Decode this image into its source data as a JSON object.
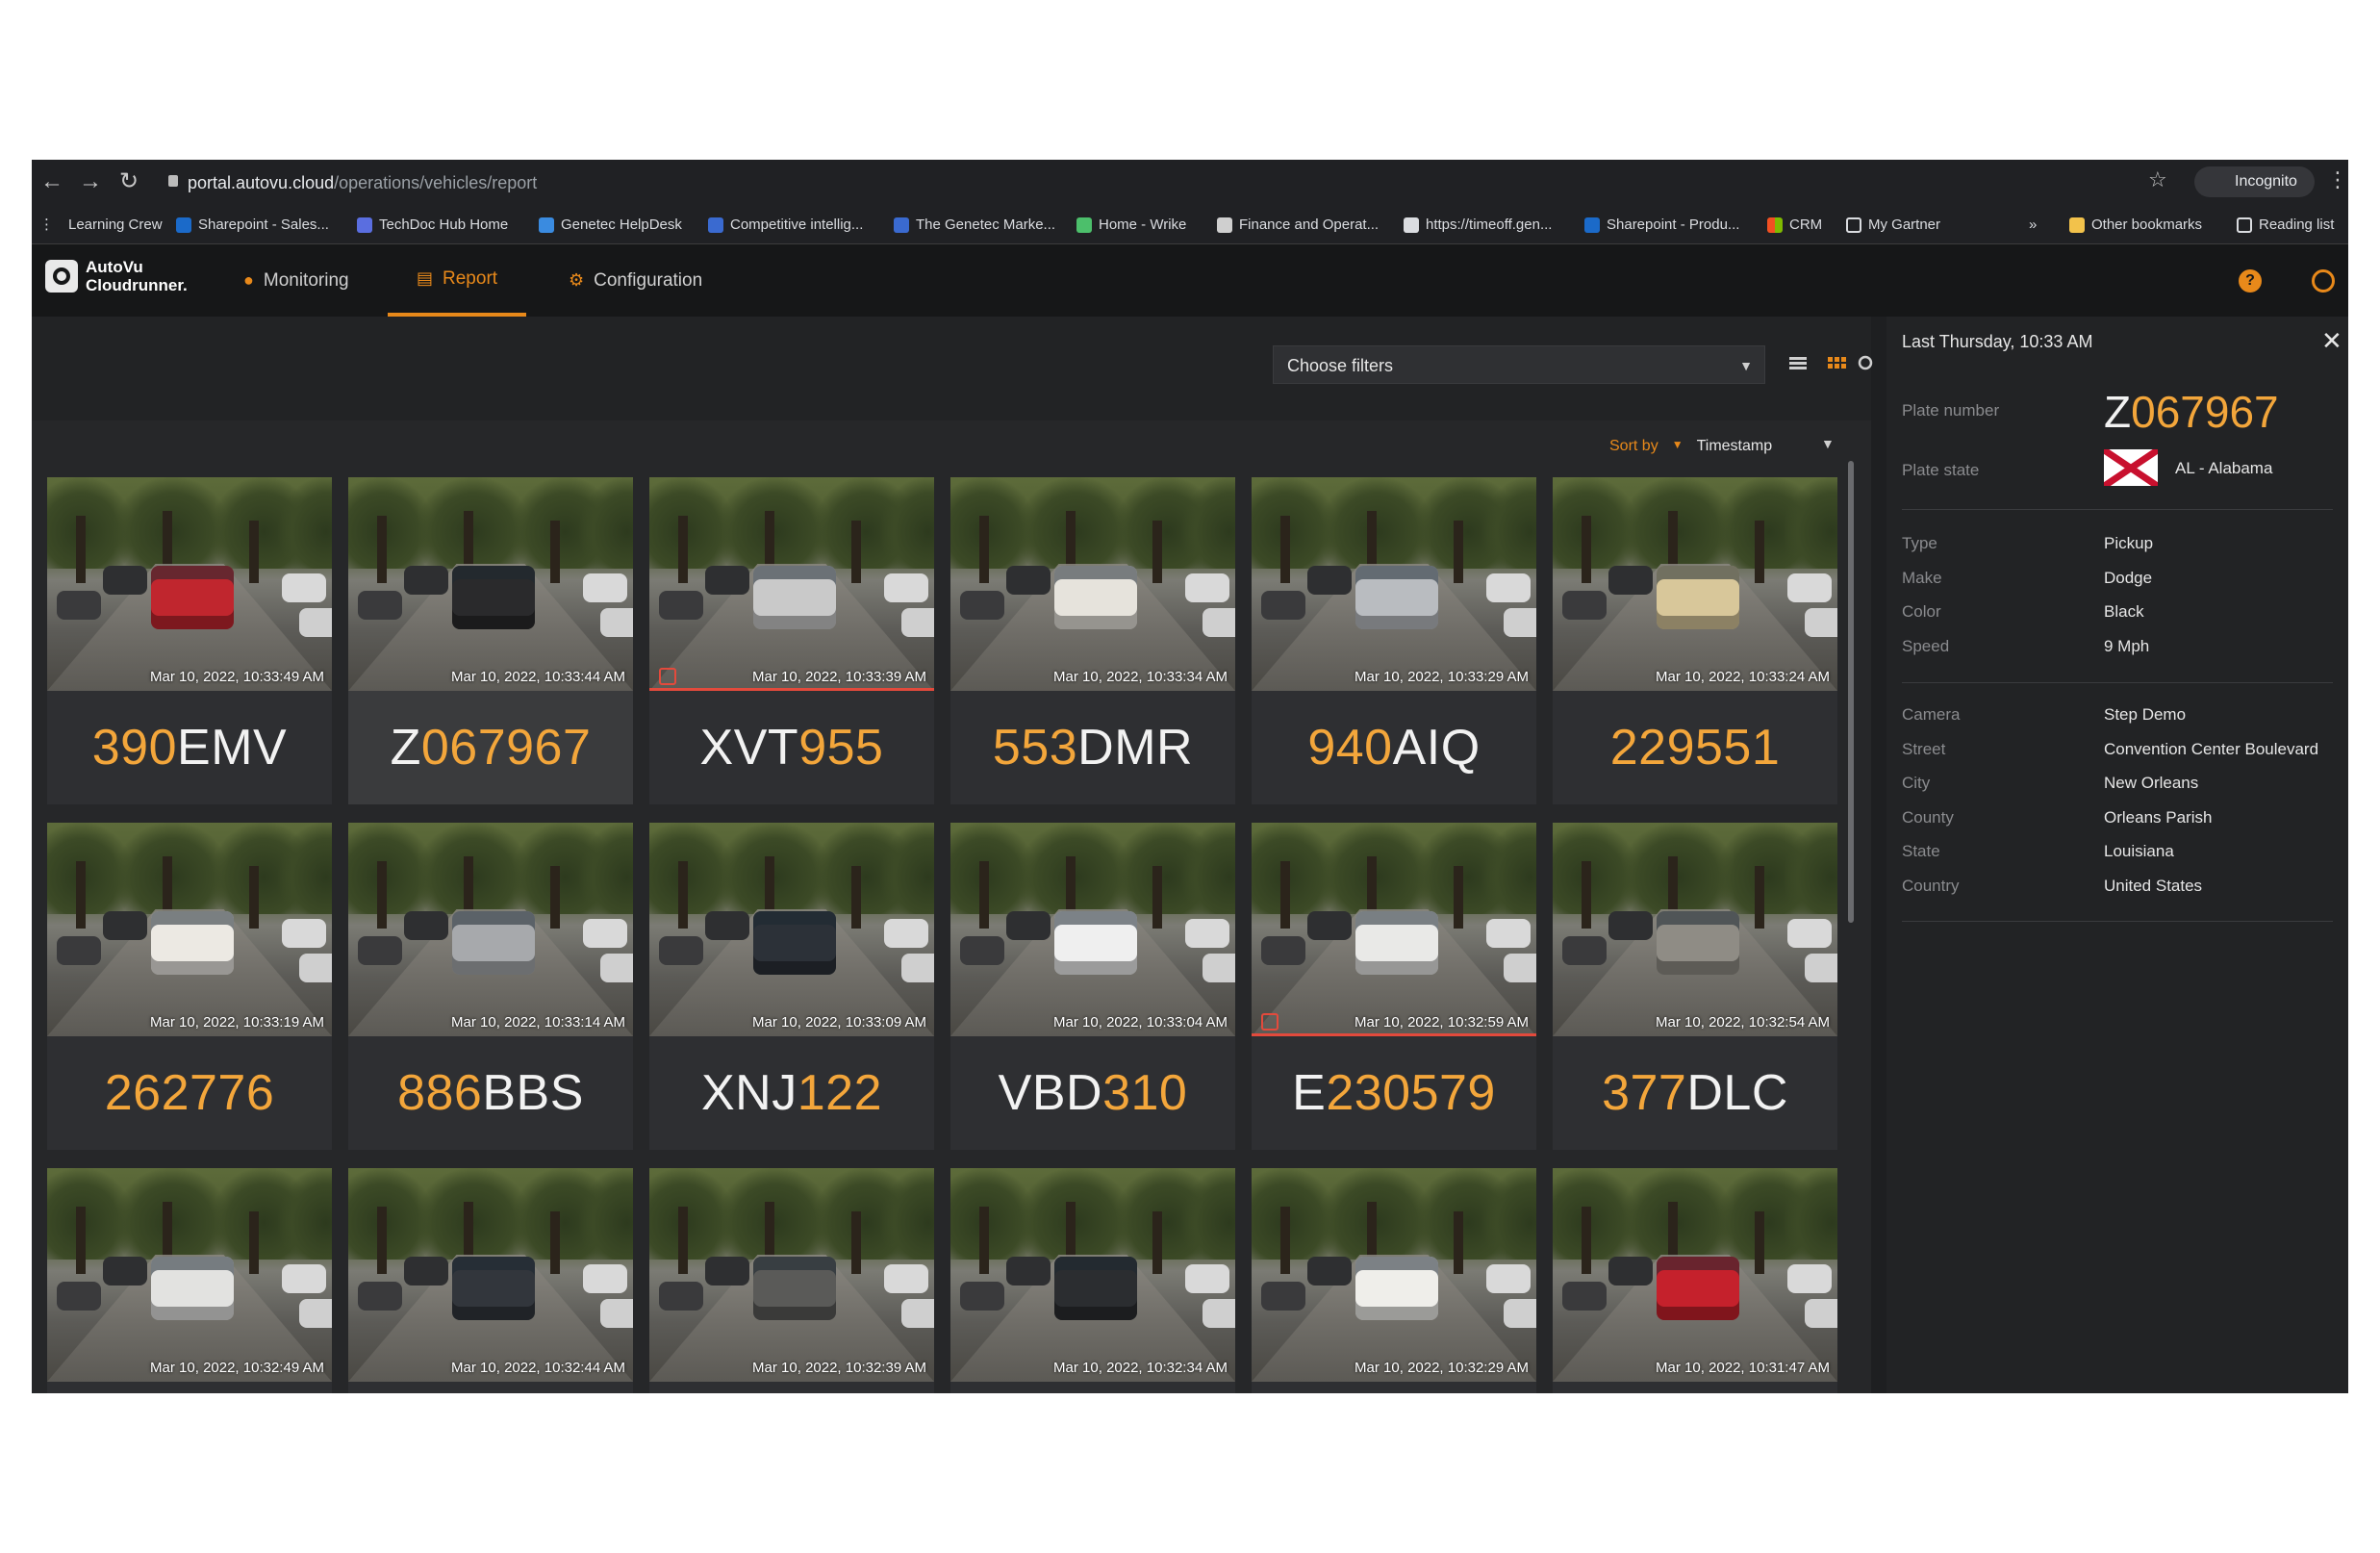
{
  "browser": {
    "url_host": "portal.autovu.cloud",
    "url_path": "/operations/vehicles/report",
    "incognito_label": "Incognito",
    "bookmarks": [
      {
        "label": "Learning Crew",
        "icon": "bookmark-icon",
        "color": "#8a8b8e"
      },
      {
        "label": "Sharepoint - Sales...",
        "icon": "sharepoint-icon",
        "color": "#1b6ac9"
      },
      {
        "label": "TechDoc Hub Home",
        "icon": "techdoc-icon",
        "color": "#5a6ee0"
      },
      {
        "label": "Genetec HelpDesk",
        "icon": "helpdesk-icon",
        "color": "#3a8be0"
      },
      {
        "label": "Competitive intellig...",
        "icon": "competitive-icon",
        "color": "#3a6ad0"
      },
      {
        "label": "The Genetec Marke...",
        "icon": "genetec-icon",
        "color": "#3a6ad0"
      },
      {
        "label": "Home - Wrike",
        "icon": "wrike-icon",
        "color": "#4cbf6b"
      },
      {
        "label": "Finance and Operat...",
        "icon": "finance-icon",
        "color": "#cfcfcf"
      },
      {
        "label": "https://timeoff.gen...",
        "icon": "page-icon",
        "color": "#dadce0"
      },
      {
        "label": "Sharepoint - Produ...",
        "icon": "sharepoint-icon",
        "color": "#1b6ac9"
      },
      {
        "label": "CRM",
        "icon": "crm-icon",
        "color": "#f25022"
      },
      {
        "label": "My Gartner",
        "icon": "gartner-icon",
        "color": "#dadce0"
      }
    ],
    "more_label": "»",
    "other_bookmarks": "Other bookmarks",
    "reading_list": "Reading list"
  },
  "app": {
    "logo_line1": "AutoVu",
    "logo_line2": "Cloudrunner.",
    "tabs": [
      {
        "label": "Monitoring"
      },
      {
        "label": "Report"
      },
      {
        "label": "Configuration"
      }
    ],
    "accent_color": "#e8891a"
  },
  "toolbar": {
    "filter_placeholder": "Choose filters",
    "sort_label": "Sort by",
    "sort_value": "Timestamp"
  },
  "reads": [
    {
      "plate_o": "390",
      "plate_w": "EMV",
      "timestamp": "Mar 10, 2022, 10:33:49 AM",
      "hotlist": false,
      "car_color": "#c0262e"
    },
    {
      "plate_o": "",
      "plate_w": "Z",
      "plate_tail": "067967",
      "timestamp": "Mar 10, 2022, 10:33:44 AM",
      "hotlist": false,
      "selected": true,
      "car_color": "#2a2a2c"
    },
    {
      "plate_o": "955",
      "plate_w": "XVT",
      "order": "wo",
      "timestamp": "Mar 10, 2022, 10:33:39 AM",
      "hotlist": true,
      "car_color": "#c9c9c9"
    },
    {
      "plate_o": "553",
      "plate_w": "DMR",
      "timestamp": "Mar 10, 2022, 10:33:34 AM",
      "hotlist": false,
      "car_color": "#e6e3dc"
    },
    {
      "plate_o": "940",
      "plate_w": "AIQ",
      "timestamp": "Mar 10, 2022, 10:33:29 AM",
      "hotlist": false,
      "car_color": "#b9bcc0"
    },
    {
      "plate_o": "229551",
      "plate_w": "",
      "timestamp": "Mar 10, 2022, 10:33:24 AM",
      "hotlist": false,
      "car_color": "#d8c79a"
    },
    {
      "plate_o": "262776",
      "plate_w": "",
      "timestamp": "Mar 10, 2022, 10:33:19 AM",
      "hotlist": false,
      "car_color": "#ece9e3"
    },
    {
      "plate_o": "886",
      "plate_w": "BBS",
      "timestamp": "Mar 10, 2022, 10:33:14 AM",
      "hotlist": false,
      "car_color": "#a7a9ac"
    },
    {
      "plate_o": "122",
      "plate_w": "XNJ",
      "order": "wo",
      "timestamp": "Mar 10, 2022, 10:33:09 AM",
      "hotlist": false,
      "car_color": "#2c3138"
    },
    {
      "plate_o": "310",
      "plate_w": "VBD",
      "order": "wo",
      "timestamp": "Mar 10, 2022, 10:33:04 AM",
      "hotlist": false,
      "car_color": "#efefef"
    },
    {
      "plate_o": "",
      "plate_w": "E",
      "plate_tail": "230579",
      "timestamp": "Mar 10, 2022, 10:32:59 AM",
      "hotlist": true,
      "car_color": "#e9e9e7"
    },
    {
      "plate_o": "377",
      "plate_w": "DLC",
      "timestamp": "Mar 10, 2022, 10:32:54 AM",
      "hotlist": false,
      "car_color": "#8f8c85"
    },
    {
      "plate_o": "",
      "plate_w": "",
      "timestamp": "Mar 10, 2022, 10:32:49 AM",
      "hotlist": false,
      "car_color": "#e2e2e0"
    },
    {
      "plate_o": "",
      "plate_w": "",
      "timestamp": "Mar 10, 2022, 10:32:44 AM",
      "hotlist": false,
      "car_color": "#32363c"
    },
    {
      "plate_o": "",
      "plate_w": "",
      "timestamp": "Mar 10, 2022, 10:32:39 AM",
      "hotlist": false,
      "car_color": "#5a5a58"
    },
    {
      "plate_o": "",
      "plate_w": "",
      "timestamp": "Mar 10, 2022, 10:32:34 AM",
      "hotlist": false,
      "car_color": "#2b2d30"
    },
    {
      "plate_o": "",
      "plate_w": "",
      "timestamp": "Mar 10, 2022, 10:32:29 AM",
      "hotlist": false,
      "car_color": "#efeeea"
    },
    {
      "plate_o": "",
      "plate_w": "",
      "timestamp": "Mar 10, 2022, 10:31:47 AM",
      "hotlist": false,
      "car_color": "#c5212c"
    }
  ],
  "detail": {
    "title": "Last Thursday, 10:33 AM",
    "plate_number_label": "Plate number",
    "plate_w": "Z",
    "plate_o": "067967",
    "plate_state_label": "Plate state",
    "plate_state": "AL - Alabama",
    "type_label": "Type",
    "type": "Pickup",
    "make_label": "Make",
    "make": "Dodge",
    "color_label": "Color",
    "color": "Black",
    "speed_label": "Speed",
    "speed": "9 Mph",
    "camera_label": "Camera",
    "camera": "Step Demo",
    "street_label": "Street",
    "street": "Convention Center Boulevard",
    "city_label": "City",
    "city": "New Orleans",
    "county_label": "County",
    "county": "Orleans Parish",
    "state_label": "State",
    "state": "Louisiana",
    "country_label": "Country",
    "country": "United States"
  }
}
